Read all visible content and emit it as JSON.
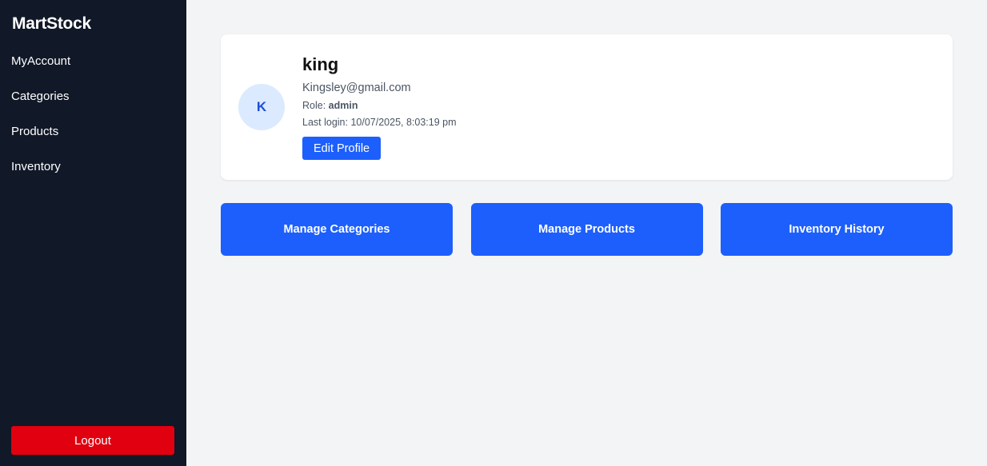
{
  "sidebar": {
    "brand": "MartStock",
    "nav": [
      {
        "label": "MyAccount"
      },
      {
        "label": "Categories"
      },
      {
        "label": "Products"
      },
      {
        "label": "Inventory"
      }
    ],
    "logout_label": "Logout"
  },
  "profile": {
    "avatar_initial": "K",
    "name": "king",
    "email": "Kingsley@gmail.com",
    "role_label": "Role:",
    "role_value": "admin",
    "last_login_label": "Last login:",
    "last_login_value": "10/07/2025, 8:03:19 pm",
    "edit_label": "Edit Profile"
  },
  "actions": [
    {
      "label": "Manage Categories"
    },
    {
      "label": "Manage Products"
    },
    {
      "label": "Inventory History"
    }
  ],
  "colors": {
    "sidebar_bg": "#111827",
    "accent": "#1d5ffc",
    "logout": "#e0000f",
    "page_bg": "#f3f4f6",
    "avatar_bg": "#dbeafe"
  }
}
